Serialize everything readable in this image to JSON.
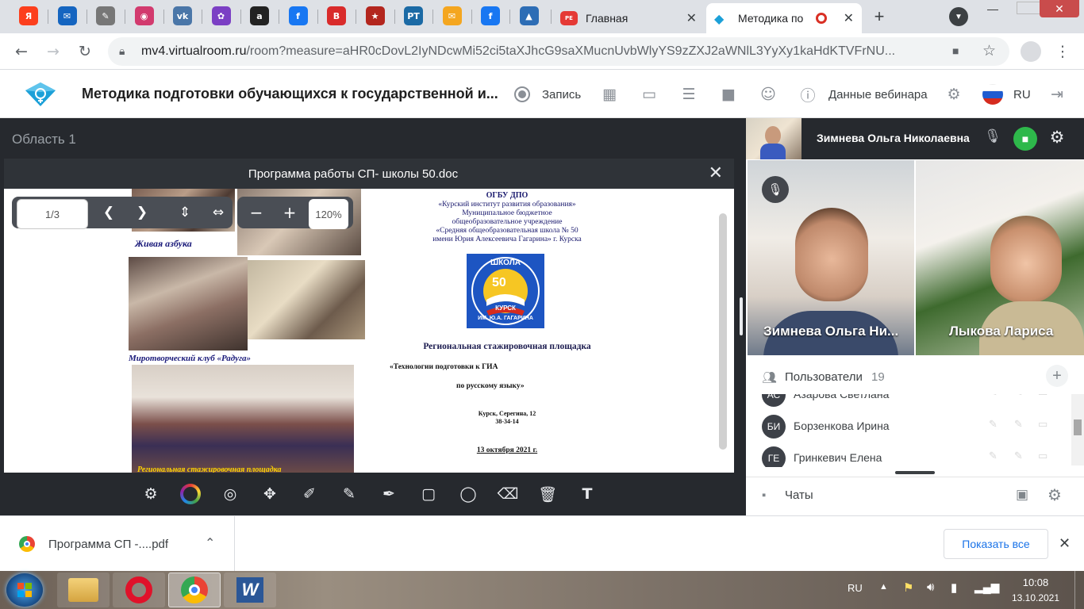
{
  "browser": {
    "tabs": [
      {
        "icon": "yandex-icon",
        "letter": "Я",
        "color": "#fc3f1d"
      },
      {
        "icon": "mail-icon",
        "letter": "✉",
        "color": "#1565c0"
      },
      {
        "icon": "document-icon",
        "letter": "✎",
        "color": "#777777"
      },
      {
        "icon": "photo-icon",
        "letter": "◉",
        "color": "#d23a6e"
      },
      {
        "icon": "vk-icon",
        "letter": "vk",
        "color": "#4a76a8"
      },
      {
        "icon": "flower-icon",
        "letter": "✿",
        "color": "#7b3fc4"
      },
      {
        "icon": "app-icon",
        "letter": "a",
        "color": "#222222"
      },
      {
        "icon": "facebook-icon",
        "letter": "f",
        "color": "#1877f2"
      },
      {
        "icon": "b-icon",
        "letter": "B",
        "color": "#d92b2b"
      },
      {
        "icon": "star-icon",
        "letter": "★",
        "color": "#b3261e"
      },
      {
        "icon": "rt-icon",
        "letter": "РТ",
        "color": "#1b6aa5"
      },
      {
        "icon": "envelope-icon",
        "letter": "✉",
        "color": "#f4a620"
      },
      {
        "icon": "facebook-icon",
        "letter": "f",
        "color": "#1877f2"
      },
      {
        "icon": "chart-icon",
        "letter": "▲",
        "color": "#2d6db5"
      }
    ],
    "tab_main": "Главная",
    "tab_active": "Методика по",
    "address": {
      "host": "mv4.virtualroom.ru",
      "path": "/room?measure=aHR0cDovL2IyNDcwMi52ci5taXJhcG9saXMucnUvbWlyYS9zZXJ2aWNlL3YyXy1kaHdKTVFrNU..."
    }
  },
  "app": {
    "title": "Методика подготовки обучающихся к государственной и...",
    "record_label": "Запись",
    "webinar_data_label": "Данные вебинара",
    "lang_label": "RU"
  },
  "stage": {
    "area_title": "Область 1",
    "doc_title": "Программа работы СП- школы 50.doc",
    "page_indicator": "1/3",
    "zoom": "120%"
  },
  "document": {
    "captions": [
      "Живая азбука",
      "Миротворческий клуб «Радуга»",
      "Региональная стажировочная площадка"
    ],
    "org_lines": [
      "ОГБУ ДПО",
      "«Курский институт развития образования»",
      "Муниципальное бюджетное",
      "общеобразовательное учреждение",
      "«Средняя общеобразовательная школа № 50",
      "имени Юрия Алексеевича Гагарина» г. Курска"
    ],
    "logo_top": "ШКОЛА",
    "logo_number": "50",
    "logo_city": "КУРСК",
    "logo_name": "ИМ. Ю.А. ГАГАРИНА",
    "heading": "Региональная стажировочная площадка",
    "topic_line1": "«Технологии подготовки к ГИА",
    "topic_line2": "по русскому языку»",
    "address_line1": "Курск, Серегина, 12",
    "address_line2": "38-34-14",
    "date": "13 октября 2021 г."
  },
  "right_panel": {
    "host_name": "Зимнева Ольга Николаевна",
    "videos": [
      {
        "name": "Зимнева Ольга Ни..."
      },
      {
        "name": "Лыкова Лариса"
      }
    ],
    "users_label": "Пользователи",
    "users_count": "19",
    "users": [
      {
        "initials": "АС",
        "name": "Азарова Светлана"
      },
      {
        "initials": "БИ",
        "name": "Борзенкова Ирина"
      },
      {
        "initials": "ГЕ",
        "name": "Гринкевич Елена"
      }
    ],
    "chats_label": "Чаты"
  },
  "download": {
    "file_name": "Программа СП -....pdf",
    "show_all": "Показать все"
  },
  "taskbar": {
    "lang": "RU",
    "time": "10:08",
    "date": "13.10.2021"
  }
}
